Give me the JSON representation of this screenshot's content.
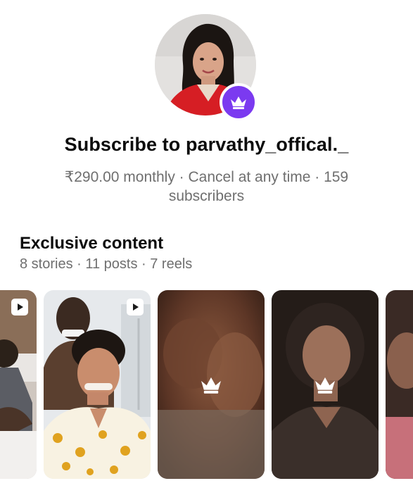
{
  "header": {
    "avatar_icon": "profile-photo",
    "badge_icon": "crown-icon",
    "title": "Subscribe to parvathy_offical._",
    "subtitle": "₹290.00 monthly · Cancel at any time · 159 subscribers"
  },
  "exclusive": {
    "title": "Exclusive content",
    "summary": "8 stories · 11 posts · 7 reels",
    "tiles": [
      {
        "kind": "reel",
        "locked": false,
        "icon": "play-icon"
      },
      {
        "kind": "reel",
        "locked": false,
        "icon": "play-icon"
      },
      {
        "kind": "post",
        "locked": true,
        "icon": "crown-icon"
      },
      {
        "kind": "post",
        "locked": true,
        "icon": "crown-icon"
      },
      {
        "kind": "post",
        "locked": true,
        "icon": "crown-icon"
      }
    ]
  },
  "colors": {
    "accent": "#7b3af0",
    "text": "#0c0c0c",
    "muted": "#6f6f6f",
    "background": "#ffffff"
  }
}
